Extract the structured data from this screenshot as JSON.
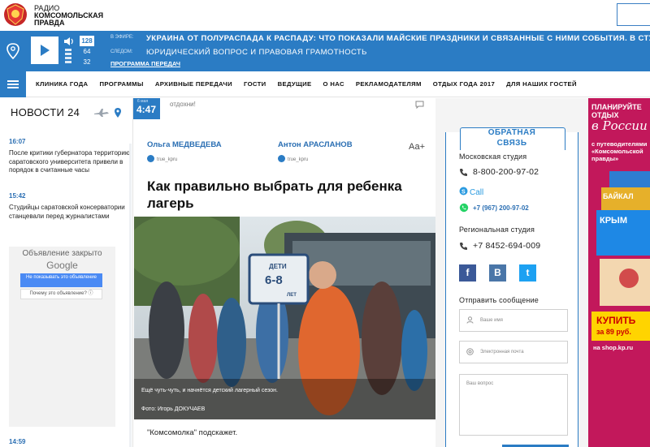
{
  "header": {
    "logo_line1": "РАДИО",
    "logo_line2": "КОМСОМОЛЬСКАЯ",
    "logo_line3": "ПРАВДА"
  },
  "radio": {
    "bitrates": [
      "128",
      "64",
      "32"
    ],
    "active_bitrate": "128",
    "onair_label": "В ЭФИРЕ:",
    "next_label": "СЛЕДОМ:",
    "onair_text": "УКРАИНА ОТ ПОЛУРАСПАДА К РАСПАДУ: ЧТО ПОКАЗАЛИ МАЙСКИЕ ПРАЗДНИКИ И СВЯЗАННЫЕ С НИМИ СОБЫТИЯ. В СТУДИИ:",
    "next_text": "ЮРИДИЧЕСКИЙ ВОПРОС И ПРАВОВАЯ ГРАМОТНОСТЬ",
    "program_link": "ПРОГРАММА ПЕРЕДАЧ"
  },
  "nav": {
    "items": [
      "КЛИНИКА ГОДА",
      "ПРОГРАММЫ",
      "АРХИВНЫЕ ПЕРЕДАЧИ",
      "ГОСТИ",
      "ВЕДУЩИЕ",
      "О НАС",
      "РЕКЛАМОДАТЕЛЯМ",
      "ОТДЫХ ГОДА 2017",
      "ДЛЯ НАШИХ ГОСТЕЙ"
    ]
  },
  "news": {
    "title": "НОВОСТИ 24",
    "items": [
      {
        "time": "16:07",
        "text": "После критики губернатора территорию саратовского университета привели в порядок в считанные часы"
      },
      {
        "time": "15:42",
        "text": "Студийцы саратовской консерватории станцевали перед журналистами"
      },
      {
        "time": "14:59",
        "text": ""
      }
    ]
  },
  "ad_left": {
    "closed_text": "Объявление закрыто",
    "brand": "Google",
    "button1": "Не показывать это объявление",
    "button2": "Почему это объявление? ⓘ"
  },
  "article": {
    "time_small": "6 мая",
    "time": "4:47",
    "top_snippet": "отдохни!",
    "author1": "Ольга МЕДВЕДЕВА",
    "author2": "Антон АРАСЛАНОВ",
    "tg_handle": "true_kpru",
    "font_toggle": "Аа+",
    "title": "Как правильно выбрать для ребенка лагерь",
    "caption": "Ещё чуть-чуть, и начнётся детский лагерный сезон.",
    "credit": "Фото: Игорь ДОКУЧАЕВ",
    "sign_text1": "ДЕТИ",
    "sign_text2": "6-8",
    "sign_text3": "ЛЕТ",
    "lead": "\"Комсомолка\" подскажет."
  },
  "feedback": {
    "title_line1": "ОБРАТНАЯ",
    "title_line2": "СВЯЗЬ",
    "moscow_label": "Московская студия",
    "moscow_phone": "8-800-200-97-02",
    "skype": "Call",
    "whatsapp": "+7 (967) 200-97-02",
    "region_label": "Региональная студия",
    "region_phone": "+7 8452-694-009",
    "send_label": "Отправить сообщение",
    "name_placeholder": "Ваше имя",
    "email_placeholder": "Электронная почта",
    "question_placeholder": "Ваш вопрос",
    "social": [
      "f",
      "В",
      "t"
    ]
  },
  "ad_right": {
    "line1": "ПЛАНИРУЙТЕ ОТДЫХ",
    "line2": "в России",
    "line3": "с путеводителями «Комсомольской правды»",
    "book1": "БАЙКАЛ",
    "book2": "КРЫМ",
    "price1": "КУПИТЬ",
    "price2": "за 89 руб.",
    "shop": "на shop.kp.ru"
  },
  "colors": {
    "brand_blue": "#2b7cc4",
    "ad_magenta": "#c2185b"
  }
}
